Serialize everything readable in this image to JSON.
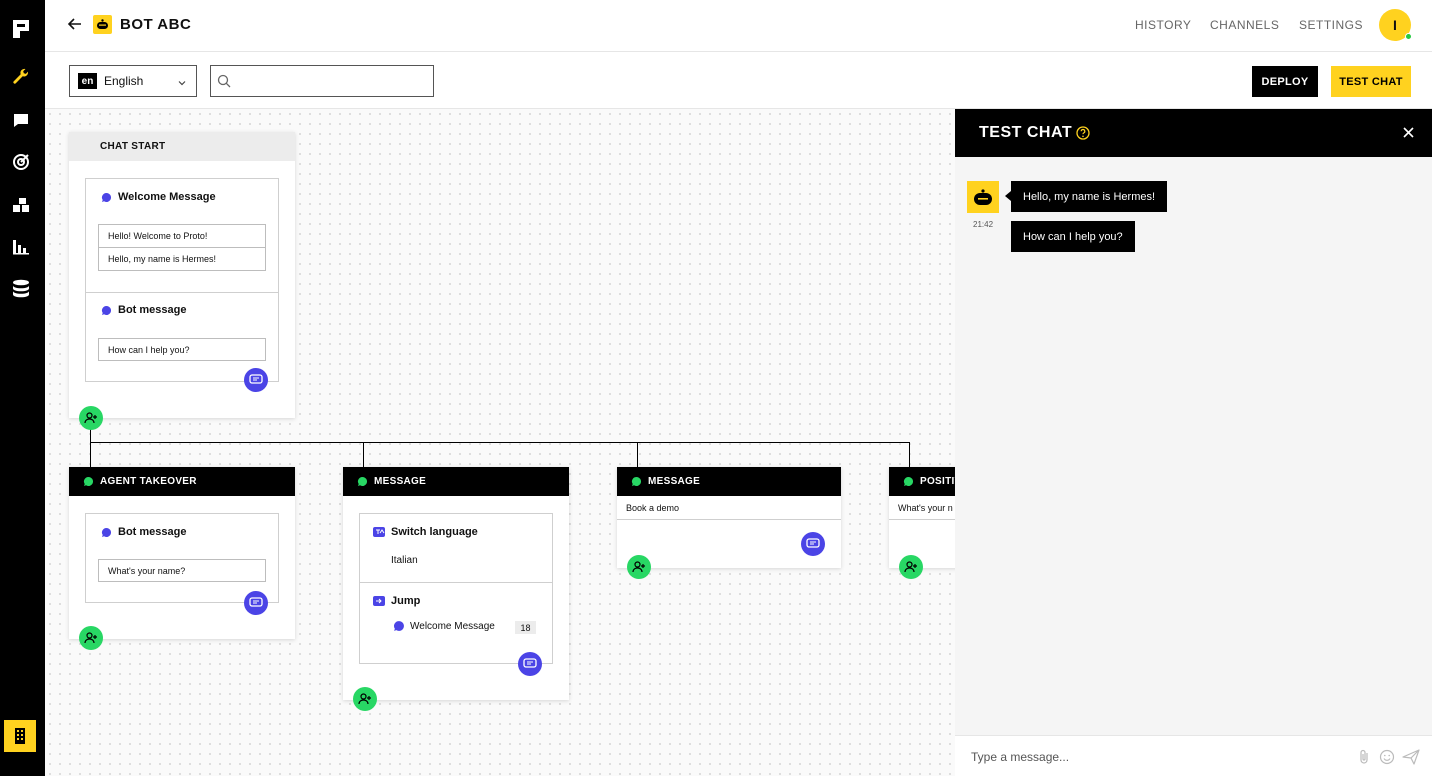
{
  "sidebar": {
    "icons": [
      "logo-icon",
      "wrench-icon",
      "chat-icon",
      "target-icon",
      "blocks-icon",
      "analytics-icon",
      "database-icon",
      "building-icon"
    ]
  },
  "header": {
    "back_icon": "arrow-left-icon",
    "bot_icon": "robot-icon",
    "title": "BOT ABC",
    "nav": [
      "HISTORY",
      "CHANNELS",
      "SETTINGS"
    ],
    "avatar_initial": "I"
  },
  "toolbar": {
    "language_code": "en",
    "language_label": "English",
    "search_value": "",
    "deploy_label": "DEPLOY",
    "test_chat_label": "TEST CHAT"
  },
  "canvas": {
    "chat_start": {
      "header": "CHAT START",
      "welcome_title": "Welcome Message",
      "welcome_lines": [
        "Hello! Welcome to Proto!",
        "Hello, my name is Hermes!"
      ],
      "bot_title": "Bot message",
      "bot_text": "How can I help you?"
    },
    "agent_takeover": {
      "header": "AGENT TAKEOVER",
      "bot_title": "Bot message",
      "bot_text": "What's your name?"
    },
    "message1": {
      "header": "MESSAGE",
      "switch_title": "Switch language",
      "switch_value": "Italian",
      "jump_title": "Jump",
      "jump_target": "Welcome Message",
      "jump_count": "18"
    },
    "message2": {
      "header": "MESSAGE",
      "text": "Book a demo"
    },
    "positive": {
      "header": "POSITIV",
      "text": "What's your n"
    }
  },
  "chat": {
    "title": "TEST CHAT",
    "time": "21:42",
    "messages": [
      "Hello, my name is Hermes!",
      "How can I help you?"
    ],
    "input_placeholder": "Type a message..."
  },
  "colors": {
    "accent_yellow": "#ffd21f",
    "node_blue": "#4b44e6",
    "add_green": "#28d764",
    "status_online": "#26c940"
  }
}
